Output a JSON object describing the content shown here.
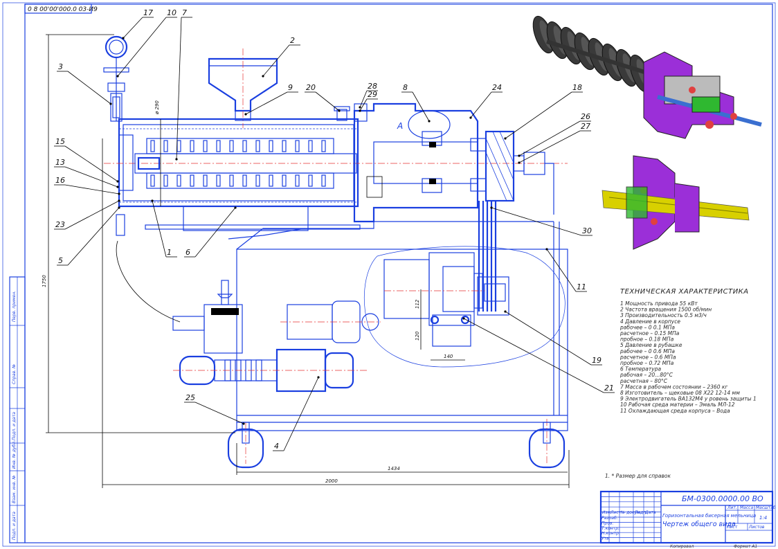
{
  "drawing": {
    "top_code": "0 8 00'00'000.0 03-И9",
    "callouts": [
      "1",
      "2",
      "3",
      "4",
      "5",
      "6",
      "7",
      "8",
      "9",
      "10",
      "11",
      "13",
      "15",
      "16",
      "17",
      "18",
      "19",
      "20",
      "21",
      "23",
      "24",
      "25",
      "26",
      "27",
      "28",
      "29",
      "30"
    ],
    "view_label": "A",
    "dims": {
      "height_overall": "1750",
      "width_overall": "2000",
      "width_inner": "1434",
      "dia_barrel": "ø 290",
      "d1": "112",
      "d2": "120",
      "d3": "140"
    },
    "note": "1. * Размер для справок"
  },
  "specs": {
    "title": "ТЕХНИЧЕСКАЯ ХАРАКТЕРИСТИКА",
    "lines": [
      "1  Мощность привода 55 кВт",
      "2  Частота вращения 1500 об/мин",
      "3  Производительность 0.5 м3/ч",
      "4  Давление в корпусе",
      "      рабочее – 0 0.1 МПа",
      "      расчетное – 0.15 МПа",
      "      пробное – 0.18 МПа",
      "5  Давление в рубашке",
      "      рабочее – 0 0.6 МПа",
      "      расчетное – 0.6 МПа",
      "      пробное – 0.72 МПа",
      "6  Температура",
      "      рабочая – 20...80°С",
      "      расчетная – 80°С",
      "7  Масса в рабочем состоянии – 2360 кг",
      "8  Изготовитель – щековые 08 Х22 12-14 мм",
      "9  Электродвигатель ВА132М4 у ровень защиты 1",
      "10  Рабочая среда материи – Эмаль МЛ-12",
      "11  Охлаждающая среда корпуса – Вода"
    ]
  },
  "title_block": {
    "doc_code": "БМ-0300.0000.00 ВО",
    "name_line1": "Горизонтальная бисерная мельница",
    "name_line2": "Чертеж общего вида",
    "col_lit": "Лит.",
    "col_mass": "Масса",
    "col_scale": "Масштаб",
    "scale": "1:4",
    "sheet": "Лист",
    "sheets": "Листов",
    "row_labels": [
      "Изм.",
      "Лист",
      "№ докум.",
      "Подп.",
      "Дата"
    ],
    "roles": [
      "Разраб.",
      "Пров.",
      "Т.контр.",
      "Н.контр.",
      "Утв."
    ],
    "copied": "Копировал",
    "format": "Формат   А1"
  },
  "side_stamps": [
    "Перв. примен.",
    "Справ. №",
    "Подп. и дата",
    "Инв. № дубл.",
    "Взам. инв. №",
    "Подп. и дата",
    "Инв. № подл."
  ]
}
